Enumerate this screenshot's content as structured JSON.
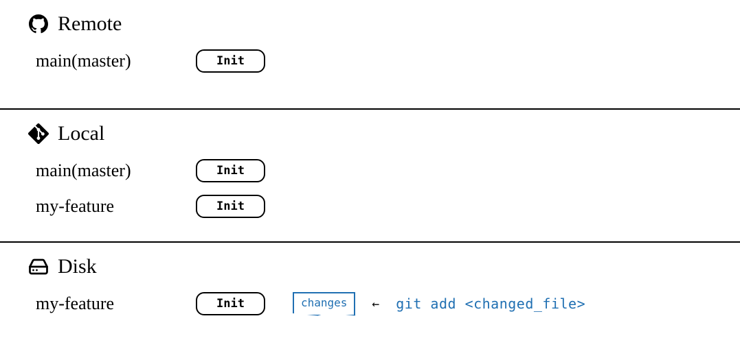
{
  "remote": {
    "title": "Remote",
    "icon": "github-icon",
    "branches": [
      {
        "name": "main(master)",
        "commit": "Init"
      }
    ]
  },
  "local": {
    "title": "Local",
    "icon": "git-icon",
    "branches": [
      {
        "name": "main(master)",
        "commit": "Init"
      },
      {
        "name": "my-feature",
        "commit": "Init"
      }
    ]
  },
  "disk": {
    "title": "Disk",
    "icon": "disk-icon",
    "branch": {
      "name": "my-feature",
      "commit": "Init"
    },
    "changes_label": "changes",
    "arrow": "←",
    "command": "git add <changed_file>"
  },
  "colors": {
    "accent": "#1f6fb2"
  }
}
